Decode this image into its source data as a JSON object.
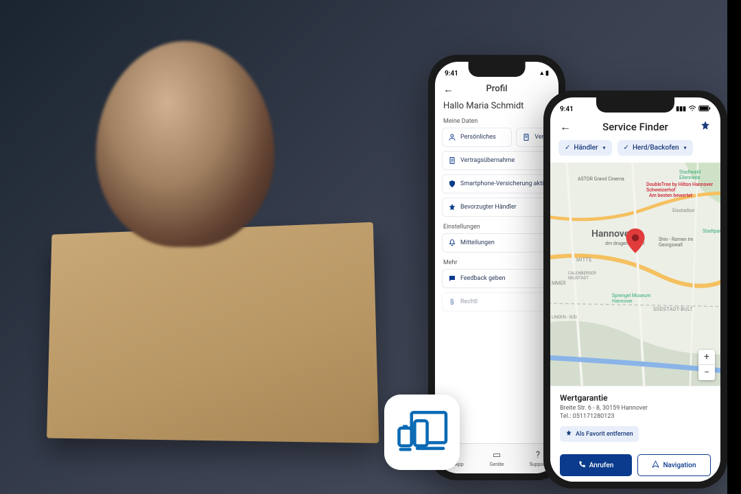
{
  "phone1": {
    "status_time": "9:41",
    "header_title": "Profil",
    "greeting": "Hallo Maria Schmidt",
    "section_meine_daten": "Meine Daten",
    "items": {
      "personal": "Persönliches",
      "vertraege": "Vertr",
      "uebernahme": "Vertragsübernahme",
      "smartphone": "Smartphone-Versicherung akti",
      "haendler": "Bevorzugter Händler"
    },
    "section_einstellungen": "Einstellungen",
    "mitteilungen": "Mitteilungen",
    "section_mehr": "Mehr",
    "feedback": "Feedback geben",
    "rechtl": "Rechtl",
    "tabs": {
      "dieapp": "die App",
      "geraete": "Geräte",
      "support": "Support"
    }
  },
  "phone2": {
    "status_time": "9:41",
    "header_title": "Service Finder",
    "chip_haendler": "Händler",
    "chip_herd": "Herd/Backofen",
    "map_city": "Hannover",
    "map_poi1": "ASTOR Grand Cinema",
    "map_poi2": "DoubleTree by Hilton Hannover Schweizerhof",
    "map_poi2b": "Am besten bewertet",
    "map_poi3": "dm drogerie markt",
    "map_poi4": "Shin - Ramen im Georgswall",
    "map_poi5": "Sprengel Museum Hannover",
    "map_poi6": "Stadtwald Eilenriede",
    "map_poi7": "Stadtpark",
    "map_area1": "MITTE",
    "map_area2": "CALENBERGER NEUSTADT",
    "map_area3": "SÜDSTADT-BULT",
    "map_area4": "MMER",
    "map_area5": "Eisstadion",
    "map_area6": "LINDEN - SÜD",
    "card": {
      "name": "Wertgarantie",
      "addr": "Breite Str. 6 - 8, 30159 Hannover",
      "tel": "Tel.: 051171280123",
      "favorite": "Als Favorit entfernen",
      "call": "Anrufen",
      "nav": "Navigation"
    }
  },
  "colors": {
    "brand": "#0a3b8c",
    "chipbg": "#e9effa"
  }
}
